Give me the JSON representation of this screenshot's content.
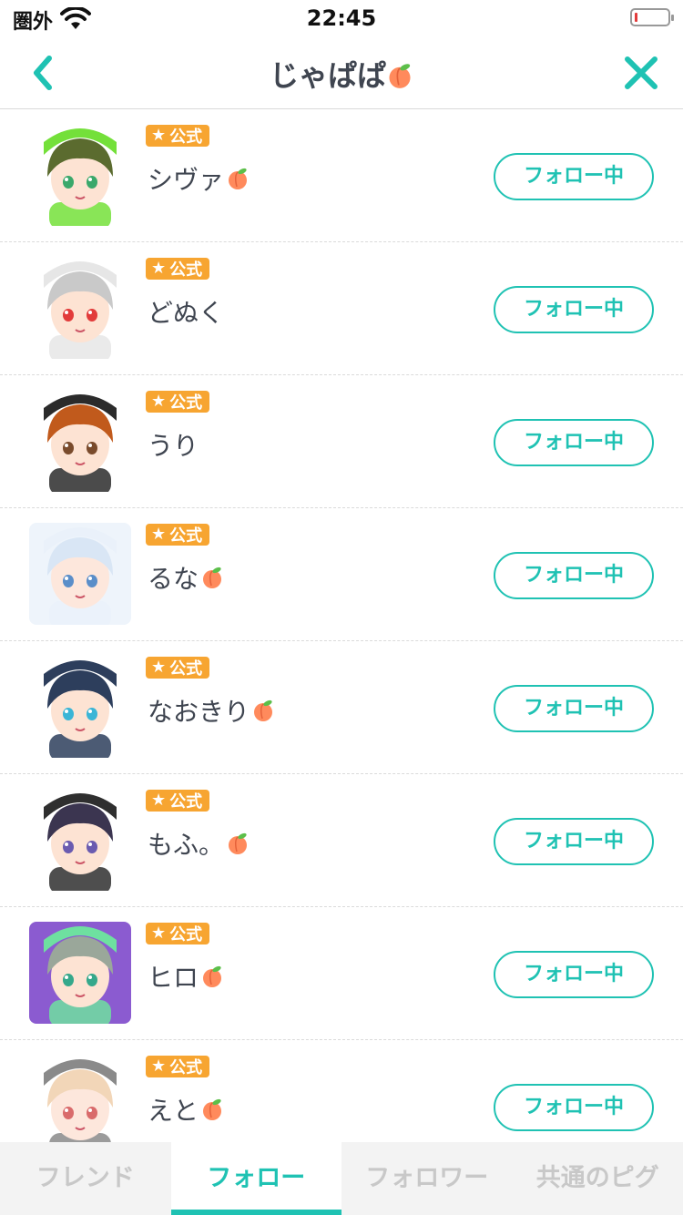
{
  "status": {
    "carrier": "圏外",
    "time": "22:45"
  },
  "nav": {
    "title": "じゃぱぱ"
  },
  "badge_label": "公式",
  "follow_label": "フォロー中",
  "users": [
    {
      "name": "シヴァ",
      "peach": true,
      "avatar": {
        "bg": "#ffffff",
        "hair": "#5b6b2f",
        "hat": "#74e03a",
        "skin": "#fde3d3",
        "eye": "#3aa86b"
      }
    },
    {
      "name": "どぬく",
      "peach": false,
      "avatar": {
        "bg": "#ffffff",
        "hair": "#c9c9c9",
        "hat": "#e6e6e6",
        "skin": "#fde3d3",
        "eye": "#e23b3b"
      }
    },
    {
      "name": "うり",
      "peach": false,
      "avatar": {
        "bg": "#ffffff",
        "hair": "#c15a1c",
        "hat": "#2b2b2b",
        "skin": "#fde3d3",
        "eye": "#7a4b2c"
      }
    },
    {
      "name": "るな",
      "peach": true,
      "avatar": {
        "bg": "#eef4fb",
        "hair": "#d9e6f5",
        "hat": "#eaf1fa",
        "skin": "#fde7dc",
        "eye": "#5a8ec9"
      }
    },
    {
      "name": "なおきり",
      "peach": true,
      "avatar": {
        "bg": "#ffffff",
        "hair": "#2d3e5c",
        "hat": "#2d3e5c",
        "skin": "#fde3d3",
        "eye": "#3bb5d6"
      }
    },
    {
      "name": "もふ。",
      "peach": true,
      "avatar": {
        "bg": "#ffffff",
        "hair": "#3b3550",
        "hat": "#2f2f2f",
        "skin": "#fde3d3",
        "eye": "#6a5bb0"
      }
    },
    {
      "name": "ヒロ",
      "peach": true,
      "avatar": {
        "bg": "#8b5bd0",
        "hair": "#9aa79a",
        "hat": "#6ee0a0",
        "skin": "#fde3d3",
        "eye": "#35a88b"
      }
    },
    {
      "name": "えと",
      "peach": true,
      "avatar": {
        "bg": "#ffffff",
        "hair": "#f2d6b8",
        "hat": "#8a8a8a",
        "skin": "#fde7dc",
        "eye": "#d96b6b"
      }
    }
  ],
  "tabs": [
    {
      "label": "フレンド",
      "active": false
    },
    {
      "label": "フォロー",
      "active": true
    },
    {
      "label": "フォロワー",
      "active": false
    },
    {
      "label": "共通のピグ",
      "active": false
    }
  ],
  "colors": {
    "accent": "#1fc2b3",
    "badge": "#f7a531",
    "text": "#3f4550"
  }
}
